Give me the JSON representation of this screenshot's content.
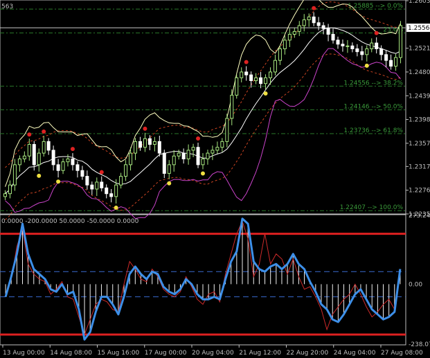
{
  "window": {
    "top_left_fragment": "563"
  },
  "chart_data": [
    {
      "type": "candlestick",
      "panel": "price",
      "title": "",
      "ylim": [
        1.2235,
        1.2603
      ],
      "y_ticks": [
        "1.26030",
        "1.25210",
        "1.24800",
        "1.24390",
        "1.23980",
        "1.23570",
        "1.23170",
        "1.22760",
        "1.22350"
      ],
      "current_price": "1.25563",
      "fib_levels": [
        {
          "price": 1.25885,
          "label": "1.25885 --> 0.0%"
        },
        {
          "price": 1.25473,
          "label": "1.25473 --> 23.6%"
        },
        {
          "price": 1.24556,
          "label": "1.24556 --> 38.2%"
        },
        {
          "price": 1.24146,
          "label": "1.24146 --> 50.0%"
        },
        {
          "price": 1.23736,
          "label": "1.23736 --> 61.8%"
        },
        {
          "price": 1.22407,
          "label": "1.22407 --> 100.0%"
        }
      ],
      "fib_label_visible": [
        "1.25885 --> 0.0%",
        "23.6%",
        "1.24556 --> 38.2%",
        "1.24146 --> 50.0%",
        "1.23736 --> 61.8%",
        "1.22407 --> 100.0%"
      ],
      "close": [
        1.227,
        1.2285,
        1.232,
        1.233,
        1.2335,
        1.2355,
        1.232,
        1.234,
        1.236,
        1.2345,
        1.232,
        1.231,
        1.2325,
        1.233,
        1.232,
        1.231,
        1.23,
        1.2285,
        1.2278,
        1.229,
        1.228,
        1.227,
        1.2265,
        1.2285,
        1.23,
        1.232,
        1.234,
        1.236,
        1.235,
        1.2365,
        1.2355,
        1.236,
        1.234,
        1.2305,
        1.232,
        1.2335,
        1.234,
        1.233,
        1.2345,
        1.235,
        1.232,
        1.233,
        1.234,
        1.2345,
        1.235,
        1.236,
        1.24,
        1.244,
        1.247,
        1.248,
        1.2475,
        1.2465,
        1.247,
        1.246,
        1.247,
        1.248,
        1.25,
        1.252,
        1.2535,
        1.2545,
        1.255,
        1.256,
        1.257,
        1.2575,
        1.2565,
        1.256,
        1.2555,
        1.2545,
        1.2535,
        1.2528,
        1.2525,
        1.2525,
        1.252,
        1.2515,
        1.251,
        1.252,
        1.253,
        1.252,
        1.251,
        1.25,
        1.249,
        1.2505,
        1.256
      ],
      "bands": {
        "upper_color": "#ffffc0",
        "mid_color": "#ffffff",
        "lower_color": "#cc44cc",
        "env_color": "#cc4422"
      },
      "fractal_up_color": "#dd2222",
      "fractal_down_color": "#f0e040",
      "bull_candle_color": "#a8e880",
      "bear_candle_color": "#ffffff"
    },
    {
      "type": "line",
      "panel": "cci",
      "header": "0.0000 -200.0000 50.0000 -50.0000 0.0000",
      "ylim": [
        -238.0783,
        273.2418
      ],
      "y_ticks": [
        "273.2418",
        "0.00",
        "-238.0783"
      ],
      "levels": [
        {
          "value": 200,
          "color": "#dd2020"
        },
        {
          "value": -200,
          "color": "#dd2020"
        },
        {
          "value": 50,
          "color": "#3a6ad0"
        },
        {
          "value": -50,
          "color": "#3a6ad0"
        }
      ],
      "series": [
        {
          "color": "#3d8fe8",
          "values": [
            -50,
            30,
            120,
            240,
            120,
            60,
            40,
            20,
            -20,
            -30,
            0,
            -40,
            -30,
            -100,
            -220,
            -190,
            -110,
            -50,
            -50,
            -80,
            -120,
            -50,
            40,
            70,
            40,
            20,
            50,
            40,
            -10,
            -30,
            -40,
            -20,
            20,
            0,
            -40,
            -60,
            -60,
            -50,
            -60,
            20,
            90,
            130,
            260,
            240,
            90,
            60,
            50,
            70,
            80,
            60,
            80,
            120,
            80,
            60,
            10,
            -30,
            -80,
            -100,
            -140,
            -150,
            -120,
            -80,
            -40,
            -20,
            -60,
            -100,
            -120,
            -140,
            -130,
            -110,
            60
          ]
        },
        {
          "color": "#cc2a2a",
          "values": [
            -40,
            20,
            150,
            220,
            80,
            40,
            20,
            10,
            -40,
            -20,
            10,
            -50,
            -60,
            -130,
            -200,
            -140,
            -80,
            -60,
            -70,
            -100,
            -110,
            0,
            90,
            60,
            20,
            10,
            60,
            30,
            -20,
            -40,
            -50,
            -30,
            30,
            -10,
            -60,
            -80,
            -40,
            -30,
            -70,
            40,
            120,
            200,
            250,
            180,
            30,
            80,
            200,
            80,
            120,
            100,
            40,
            100,
            30,
            -20,
            -10,
            -50,
            -100,
            -180,
            -120,
            -90,
            -60,
            -40,
            0,
            -40,
            -90,
            -130,
            -110,
            -80,
            -60,
            -100,
            40
          ]
        }
      ],
      "histogram_color": "#f2f2f2"
    }
  ],
  "x_axis": {
    "ticks": [
      "13 Aug 00:00",
      "14 Aug 08:00",
      "15 Aug 16:00",
      "17 Aug 00:00",
      "20 Aug 04:00",
      "21 Aug 12:00",
      "22 Aug 20:00",
      "24 Aug 04:00",
      "27 Aug 08:00"
    ]
  }
}
